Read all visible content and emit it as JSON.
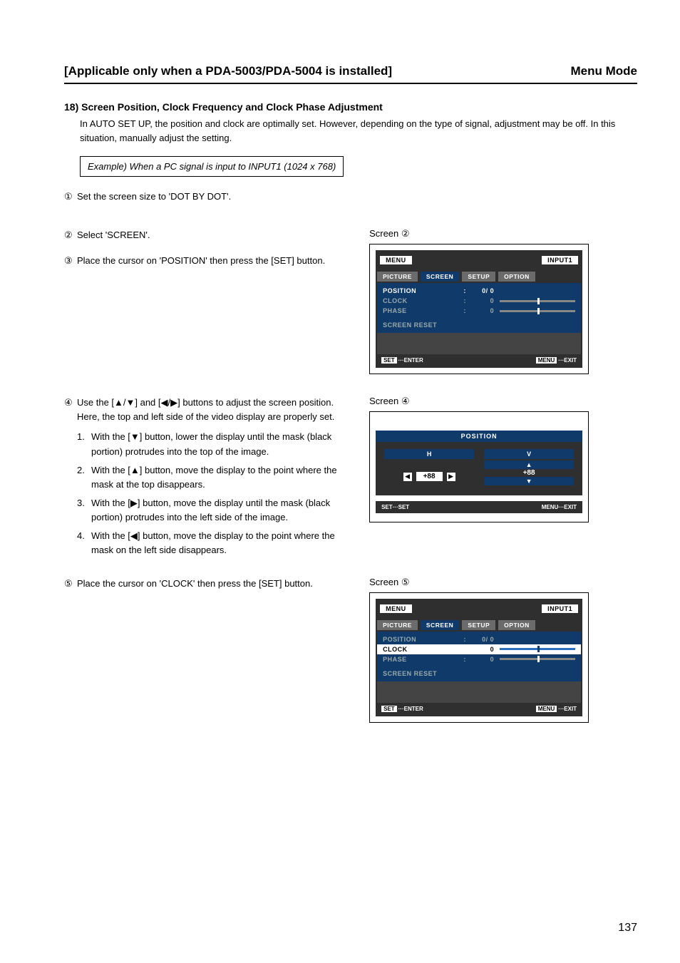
{
  "header": {
    "left": "[Applicable only when a PDA-5003/PDA-5004 is installed]",
    "right": "Menu Mode"
  },
  "section": {
    "heading": "18) Screen Position, Clock Frequency and Clock Phase Adjustment",
    "intro": "In AUTO SET UP, the position and clock are optimally set. However, depending on the type of signal, adjustment may be off. In this situation, manually adjust the setting.",
    "example": "Example) When a PC signal is input to INPUT1 (1024 x 768)"
  },
  "steps": {
    "s1": {
      "num": "①",
      "text": "Set the screen size to 'DOT BY DOT'."
    },
    "s2": {
      "num": "②",
      "text": "Select 'SCREEN'."
    },
    "s3": {
      "num": "③",
      "text": "Place the cursor on 'POSITION' then press the [SET] button."
    },
    "s4": {
      "num": "④",
      "text": "Use the [▲/▼] and [◀/▶] buttons to adjust the screen position.",
      "text2": "Here, the top and left side of the video display are properly set.",
      "sub1n": "1.",
      "sub1": "With the [▼] button, lower the display until the mask (black portion) protrudes into the top of the image.",
      "sub2n": "2.",
      "sub2": "With the [▲] button, move the display to the point where the mask at the top disappears.",
      "sub3n": "3.",
      "sub3": "With the [▶] button, move the display until the mask (black portion) protrudes into the left side of the image.",
      "sub4n": "4.",
      "sub4": "With the [◀] button, move the display to the point where the mask on the left side disappears."
    },
    "s5": {
      "num": "⑤",
      "text": "Place the cursor on 'CLOCK' then press the [SET] button."
    }
  },
  "screen_labels": {
    "s2": "Screen ②",
    "s4": "Screen ④",
    "s5": "Screen ⑤"
  },
  "osd": {
    "menu": "MENU",
    "input": "INPUT1",
    "tabs": {
      "picture": "PICTURE",
      "screen": "SCREEN",
      "setup": "SETUP",
      "option": "OPTION"
    },
    "position": "POSITION",
    "position_val": "0/ 0",
    "clock": "CLOCK",
    "clock_val": "0",
    "phase": "PHASE",
    "phase_val": "0",
    "reset": "SCREEN RESET",
    "footer_set": "SET",
    "footer_enter": "···ENTER",
    "footer_menu": "MENU",
    "footer_exit": "···EXIT",
    "footer_set2": "···SET",
    "colon": ":"
  },
  "pos_screen": {
    "title": "POSITION",
    "h": "H",
    "v": "V",
    "hval": "+88",
    "vval": "+88",
    "left": "◀",
    "right": "▶",
    "up": "▲",
    "down": "▼"
  },
  "page_number": "137"
}
